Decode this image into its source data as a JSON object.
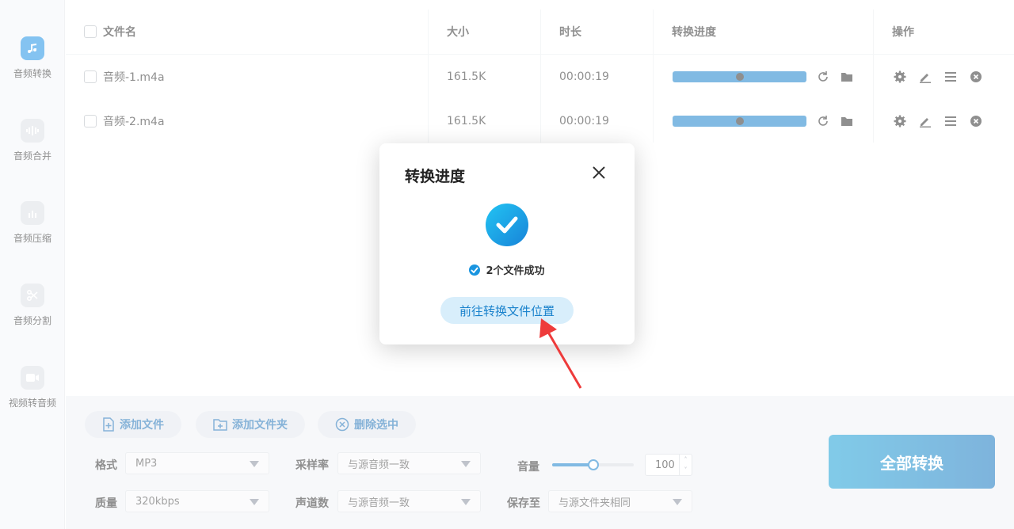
{
  "sidebar": {
    "items": [
      {
        "label": "音频转换",
        "icon": "music-note-icon"
      },
      {
        "label": "音频合并",
        "icon": "audio-merge-icon"
      },
      {
        "label": "音频压缩",
        "icon": "audio-compress-icon"
      },
      {
        "label": "音频分割",
        "icon": "scissors-icon"
      },
      {
        "label": "视频转音频",
        "icon": "video-camera-icon"
      }
    ]
  },
  "table": {
    "headers": {
      "filename": "文件名",
      "size": "大小",
      "duration": "时长",
      "progress": "转换进度",
      "actions": "操作"
    },
    "rows": [
      {
        "name": "音频-1.m4a",
        "size": "161.5K",
        "duration": "00:00:19",
        "progress": 0.5
      },
      {
        "name": "音频-2.m4a",
        "size": "161.5K",
        "duration": "00:00:19",
        "progress": 0.5
      }
    ]
  },
  "toolbar": {
    "add_file": "添加文件",
    "add_folder": "添加文件夹",
    "delete_selected": "删除选中"
  },
  "settings": {
    "format_label": "格式",
    "format_value": "MP3",
    "samplerate_label": "采样率",
    "samplerate_value": "与源音频一致",
    "volume_label": "音量",
    "volume_value": "100",
    "volume_level": 0.5,
    "quality_label": "质量",
    "quality_value": "320kbps",
    "channels_label": "声道数",
    "channels_value": "与源音频一致",
    "saveto_label": "保存至",
    "saveto_value": "与源文件夹相同"
  },
  "convert_all": "全部转换",
  "dialog": {
    "title": "转换进度",
    "success_text": "2个文件成功",
    "goto_button": "前往转换文件位置"
  },
  "colors": {
    "accent": "#1a82cc",
    "arrow": "#ee3b3b"
  }
}
